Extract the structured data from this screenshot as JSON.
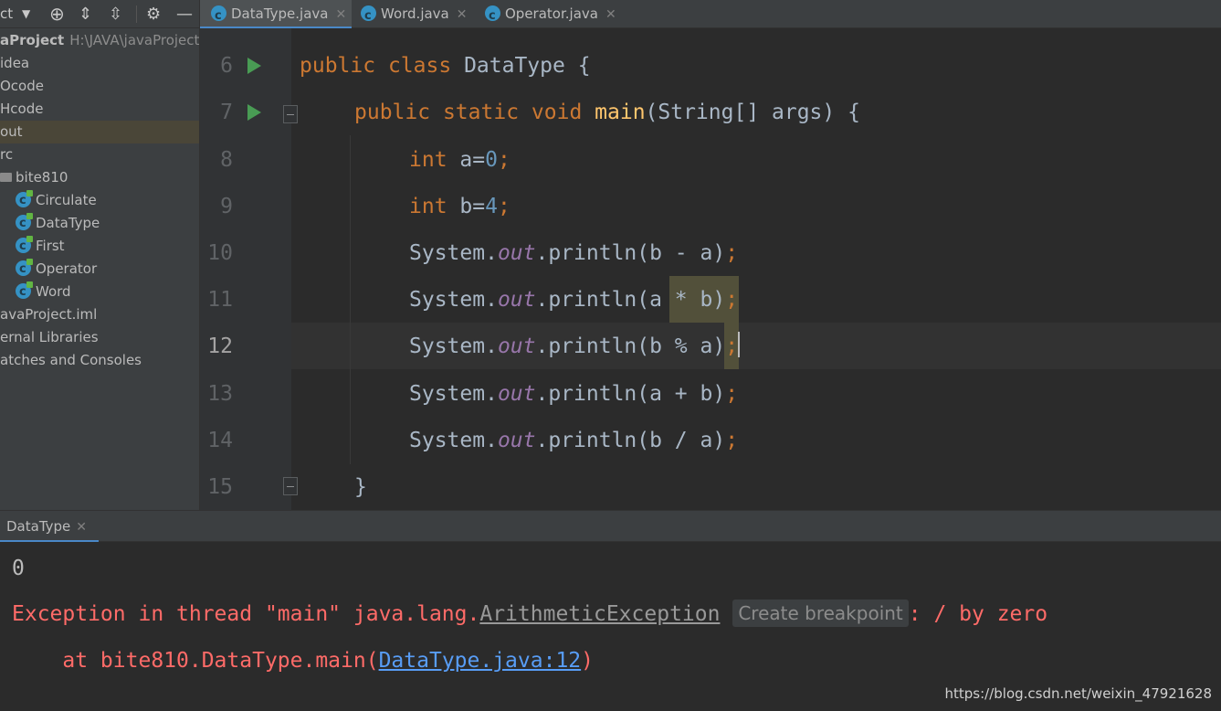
{
  "project_toolbar": {
    "title": "ct"
  },
  "project_tree": {
    "root_name": "aProject",
    "root_path": "H:\\JAVA\\javaProject",
    "items": [
      {
        "label": "idea"
      },
      {
        "label": "Ocode"
      },
      {
        "label": "Hcode"
      },
      {
        "label": "out"
      },
      {
        "label": "rc"
      },
      {
        "label": "bite810"
      },
      {
        "label": "Circulate"
      },
      {
        "label": "DataType"
      },
      {
        "label": "First"
      },
      {
        "label": "Operator"
      },
      {
        "label": "Word"
      },
      {
        "label": "avaProject.iml"
      },
      {
        "label": "ernal Libraries"
      },
      {
        "label": "atches and Consoles"
      }
    ]
  },
  "tabs": [
    {
      "label": "DataType.java",
      "active": true
    },
    {
      "label": "Word.java",
      "active": false
    },
    {
      "label": "Operator.java",
      "active": false
    }
  ],
  "editor": {
    "line_numbers": [
      "6",
      "7",
      "8",
      "9",
      "10",
      "11",
      "12",
      "13",
      "14",
      "15"
    ],
    "current_line": "12",
    "code": {
      "l6": {
        "kw1": "public",
        "kw2": "class",
        "name": "DataType",
        "brace": "{"
      },
      "l7": {
        "kw1": "public",
        "kw2": "static",
        "kw3": "void",
        "method": "main",
        "params": "(String[] args) {"
      },
      "l8": {
        "type": "int",
        "var": "a=",
        "value": "0",
        "end": ";"
      },
      "l9": {
        "type": "int",
        "var": "b=",
        "value": "4",
        "end": ";"
      },
      "l10": {
        "cls": "System.",
        "field": "out",
        "call": ".println(",
        "expr": "b - a)",
        "end": ";"
      },
      "l11": {
        "cls": "System.",
        "field": "out",
        "call": ".println(",
        "expr": "a * b)",
        "end": ";"
      },
      "l12": {
        "cls": "System.",
        "field": "out",
        "call": ".println(",
        "expr": "b % a)",
        "end": ";"
      },
      "l13": {
        "cls": "System.",
        "field": "out",
        "call": ".println(",
        "expr": "a + b)",
        "end": ";"
      },
      "l14": {
        "cls": "System.",
        "field": "out",
        "call": ".println(",
        "expr": "b / a)",
        "end": ";"
      },
      "l15": {
        "brace": "}"
      }
    }
  },
  "run_panel": {
    "tab_label": "DataType"
  },
  "console": {
    "output_line": "0",
    "exception_prefix": "Exception in thread \"main\" java.lang.",
    "exception_class": "ArithmeticException",
    "breakpoint_hint": "Create breakpoint",
    "exception_suffix": ": / by zero",
    "stack_prefix": "    at bite810.DataType.main(",
    "stack_link": "DataType.java:12",
    "stack_suffix": ")"
  },
  "watermark": "https://blog.csdn.net/weixin_47921628"
}
